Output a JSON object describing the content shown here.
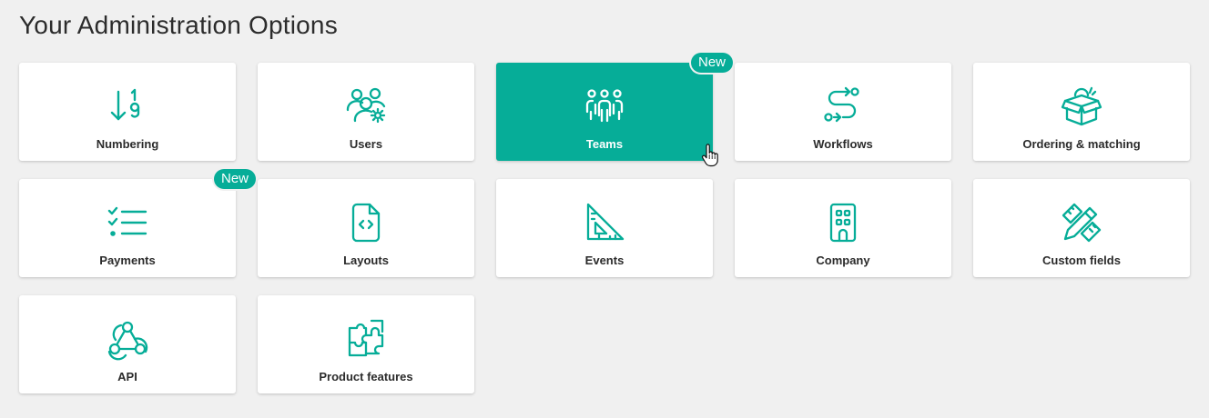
{
  "page": {
    "title": "Your Administration Options"
  },
  "colors": {
    "accent": "#06ad98",
    "background": "#f0f0f0",
    "card": "#ffffff"
  },
  "cards": [
    {
      "label": "Numbering",
      "icon": "sort-numeric-icon"
    },
    {
      "label": "Users",
      "icon": "users-settings-icon"
    },
    {
      "label": "Teams",
      "icon": "team-icon",
      "badge": "New",
      "state": "hovered"
    },
    {
      "label": "Workflows",
      "icon": "route-icon"
    },
    {
      "label": "Ordering & matching",
      "icon": "open-box-icon"
    },
    {
      "label": "Payments",
      "icon": "checklist-icon",
      "badge": "New"
    },
    {
      "label": "Layouts",
      "icon": "code-file-icon"
    },
    {
      "label": "Events",
      "icon": "set-square-icon"
    },
    {
      "label": "Company",
      "icon": "building-icon"
    },
    {
      "label": "Custom fields",
      "icon": "pencil-ruler-icon"
    },
    {
      "label": "API",
      "icon": "webhook-icon"
    },
    {
      "label": "Product features",
      "icon": "puzzle-icon"
    }
  ]
}
